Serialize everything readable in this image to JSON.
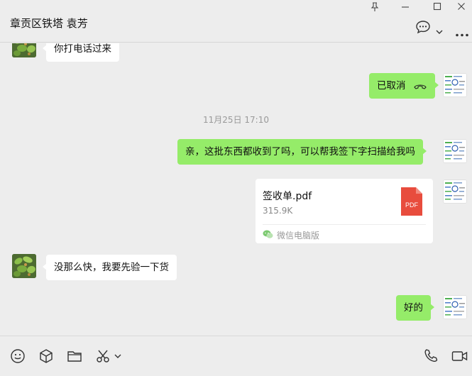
{
  "header": {
    "title": "章贡区铁塔 袁芳"
  },
  "messages": {
    "msg1_text": "你打电话过来",
    "msg2_text": "已取消",
    "timestamp": "11月25日 17:10",
    "msg3_text": "亲，这批东西都收到了吗，可以帮我签下字扫描给我吗",
    "file": {
      "name": "签收单.pdf",
      "size": "315.9K",
      "icon_label": "PDF",
      "source": "微信电脑版"
    },
    "msg4_text": "没那么快，我要先验一下货",
    "msg5_text": "好的"
  },
  "colors": {
    "outgoing_bubble": "#95ec69",
    "incoming_bubble": "#ffffff",
    "pdf_red": "#e84c3d"
  }
}
